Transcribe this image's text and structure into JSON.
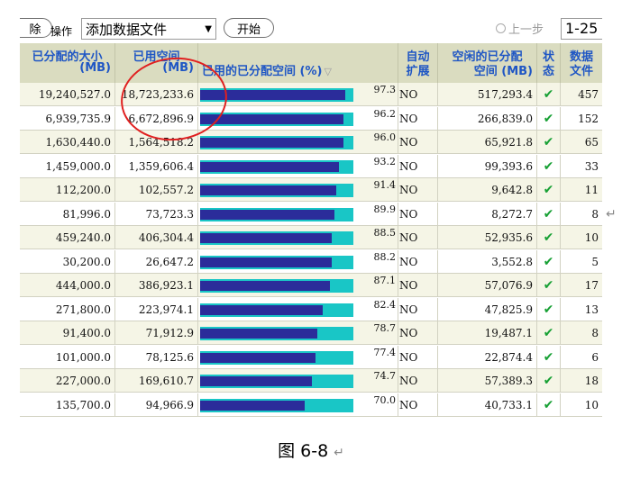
{
  "toolbar": {
    "delete_label": "除",
    "operation_label": "操作",
    "operation_value": "添加数据文件",
    "start_label": "开始",
    "prev_label": "上一步",
    "page_value": "1-25"
  },
  "columns": {
    "allocated": {
      "l1": "已分配的大小",
      "l2": "(MB)"
    },
    "used": {
      "l1": "已用空间",
      "l2": "(MB)"
    },
    "pct": {
      "l1": "已用的已分配空间 (%)"
    },
    "autoext": {
      "l1": "自动",
      "l2": "扩展"
    },
    "free": {
      "l1": "空闲的已分配",
      "l2": "空间 (MB)"
    },
    "status": {
      "l1": "状",
      "l2": "态"
    },
    "datafiles": {
      "l1": "数据",
      "l2": "文件"
    }
  },
  "rows": [
    {
      "allocated": "19,240,527.0",
      "used": "18,723,233.6",
      "pct": 97.3,
      "pct_text": "97.3",
      "autoext": "NO",
      "free": "517,293.4",
      "status": "✔",
      "datafiles": "457"
    },
    {
      "allocated": "6,939,735.9",
      "used": "6,672,896.9",
      "pct": 96.2,
      "pct_text": "96.2",
      "autoext": "NO",
      "free": "266,839.0",
      "status": "✔",
      "datafiles": "152"
    },
    {
      "allocated": "1,630,440.0",
      "used": "1,564,518.2",
      "pct": 96.0,
      "pct_text": "96.0",
      "autoext": "NO",
      "free": "65,921.8",
      "status": "✔",
      "datafiles": "65"
    },
    {
      "allocated": "1,459,000.0",
      "used": "1,359,606.4",
      "pct": 93.2,
      "pct_text": "93.2",
      "autoext": "NO",
      "free": "99,393.6",
      "status": "✔",
      "datafiles": "33"
    },
    {
      "allocated": "112,200.0",
      "used": "102,557.2",
      "pct": 91.4,
      "pct_text": "91.4",
      "autoext": "NO",
      "free": "9,642.8",
      "status": "✔",
      "datafiles": "11"
    },
    {
      "allocated": "81,996.0",
      "used": "73,723.3",
      "pct": 89.9,
      "pct_text": "89.9",
      "autoext": "NO",
      "free": "8,272.7",
      "status": "✔",
      "datafiles": "8"
    },
    {
      "allocated": "459,240.0",
      "used": "406,304.4",
      "pct": 88.5,
      "pct_text": "88.5",
      "autoext": "NO",
      "free": "52,935.6",
      "status": "✔",
      "datafiles": "10"
    },
    {
      "allocated": "30,200.0",
      "used": "26,647.2",
      "pct": 88.2,
      "pct_text": "88.2",
      "autoext": "NO",
      "free": "3,552.8",
      "status": "✔",
      "datafiles": "5"
    },
    {
      "allocated": "444,000.0",
      "used": "386,923.1",
      "pct": 87.1,
      "pct_text": "87.1",
      "autoext": "NO",
      "free": "57,076.9",
      "status": "✔",
      "datafiles": "17"
    },
    {
      "allocated": "271,800.0",
      "used": "223,974.1",
      "pct": 82.4,
      "pct_text": "82.4",
      "autoext": "NO",
      "free": "47,825.9",
      "status": "✔",
      "datafiles": "13"
    },
    {
      "allocated": "91,400.0",
      "used": "71,912.9",
      "pct": 78.7,
      "pct_text": "78.7",
      "autoext": "NO",
      "free": "19,487.1",
      "status": "✔",
      "datafiles": "8"
    },
    {
      "allocated": "101,000.0",
      "used": "78,125.6",
      "pct": 77.4,
      "pct_text": "77.4",
      "autoext": "NO",
      "free": "22,874.4",
      "status": "✔",
      "datafiles": "6"
    },
    {
      "allocated": "227,000.0",
      "used": "169,610.7",
      "pct": 74.7,
      "pct_text": "74.7",
      "autoext": "NO",
      "free": "57,389.3",
      "status": "✔",
      "datafiles": "18"
    },
    {
      "allocated": "135,700.0",
      "used": "94,966.9",
      "pct": 70.0,
      "pct_text": "70.0",
      "autoext": "NO",
      "free": "40,733.1",
      "status": "✔",
      "datafiles": "10"
    }
  ],
  "caption": "图 6-8",
  "return_mark": "↵",
  "colors": {
    "header_bg": "#dadcc0",
    "header_text": "#1f56c4",
    "bar_used": "#2b2c9a",
    "bar_total": "#19c6c6",
    "check": "#17a034",
    "annotation": "#e02020"
  }
}
